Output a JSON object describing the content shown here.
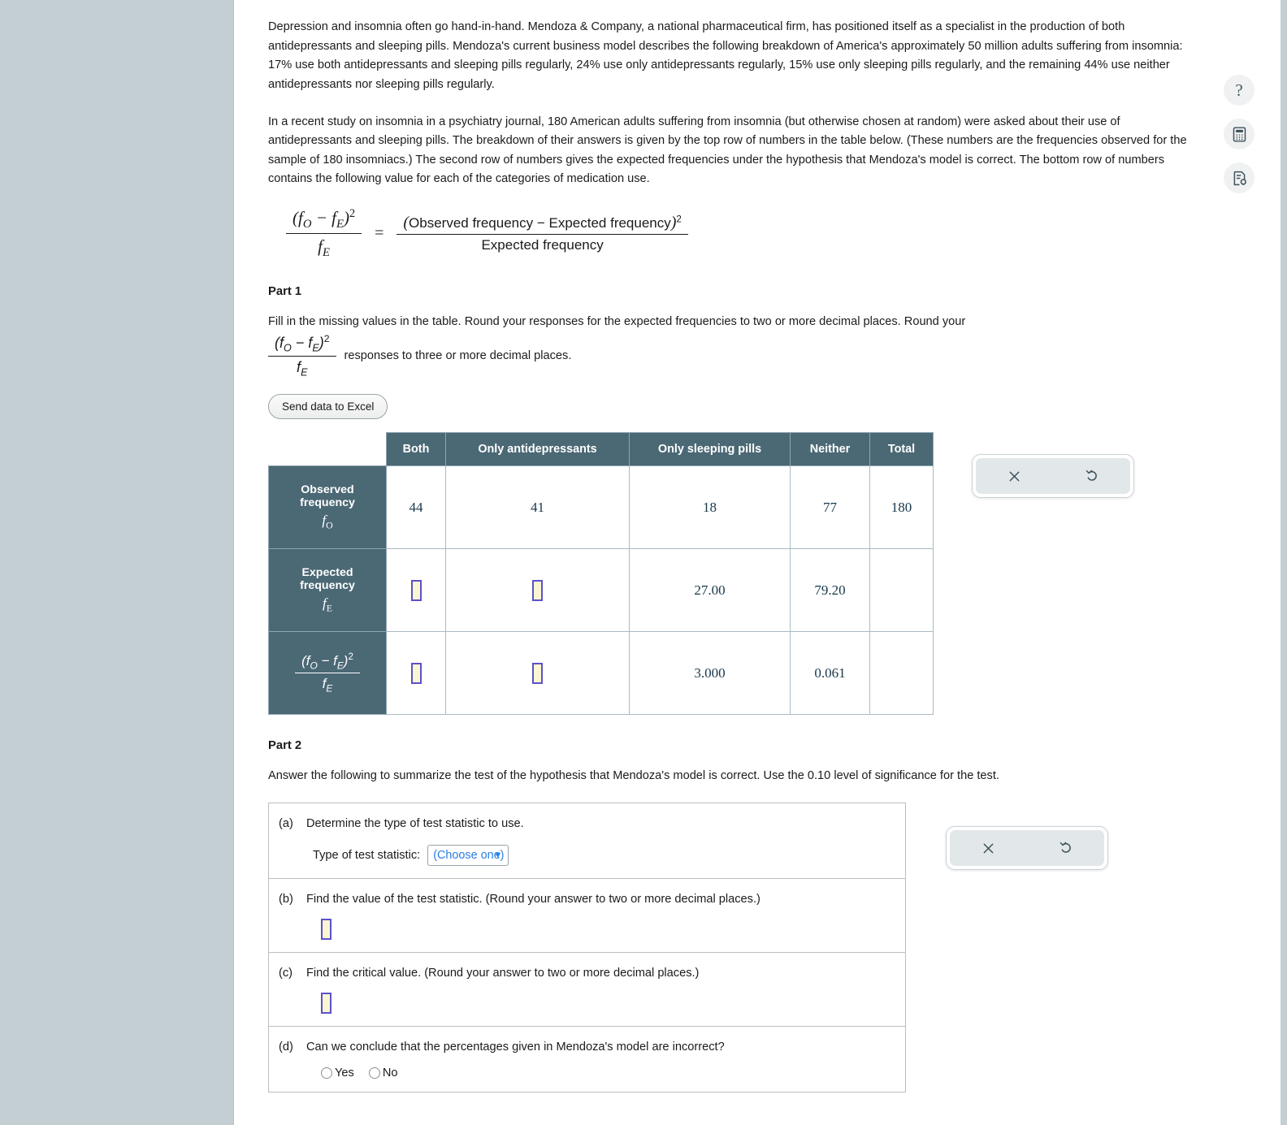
{
  "rails": {
    "left_color": "#c4cfd4",
    "right_color": "#c4cfd4"
  },
  "tool_icons": [
    {
      "name": "help-icon",
      "glyph": "?"
    },
    {
      "name": "calculator-icon",
      "glyph": "calculator"
    },
    {
      "name": "hint-icon",
      "glyph": "hint-sheet"
    }
  ],
  "intro": {
    "paragraph1": "Depression and insomnia often go hand-in-hand. Mendoza & Company, a national pharmaceutical firm, has positioned itself as a specialist in the production of both antidepressants and sleeping pills. Mendoza's current business model describes the following breakdown of America's approximately 50 million adults suffering from insomnia: 17% use both antidepressants and sleeping pills regularly, 24% use only antidepressants regularly, 15% use only sleeping pills regularly, and the remaining 44% use neither antidepressants nor sleeping pills regularly.",
    "paragraph2": "In a recent study on insomnia in a psychiatry journal, 180 American adults suffering from insomnia (but otherwise chosen at random) were asked about their use of antidepressants and sleeping pills. The breakdown of their answers is given by the top row of numbers in the table below. (These numbers are the frequencies observed for the sample of 180 insomniacs.) The second row of numbers gives the expected frequencies under the hypothesis that Mendoza's model is correct. The bottom row of numbers contains the following value for each of the categories of medication use."
  },
  "formula": {
    "lhs_numerator": "(f_O − f_E)²",
    "lhs_denominator": "f_E",
    "equals": "=",
    "rhs_numerator": "(Observed frequency − Expected frequency)²",
    "rhs_denominator": "Expected frequency"
  },
  "part1": {
    "heading": "Part 1",
    "instruction_before": "Fill in the missing values in the table. Round your responses for the expected frequencies to two or more decimal places. Round your",
    "instruction_after": "responses to three or more decimal places.",
    "excel_button": "Send data to Excel"
  },
  "table": {
    "column_headers": [
      "Both",
      "Only antidepressants",
      "Only sleeping pills",
      "Neither",
      "Total"
    ],
    "rows": [
      {
        "label_line1": "Observed",
        "label_line2": "frequency",
        "symbol": "f_O",
        "values": [
          "44",
          "41",
          "18",
          "77",
          "180"
        ],
        "inputs": [
          false,
          false,
          false,
          false,
          false
        ]
      },
      {
        "label_line1": "Expected",
        "label_line2": "frequency",
        "symbol": "f_E",
        "values": [
          "",
          "",
          "27.00",
          "79.20",
          ""
        ],
        "inputs": [
          true,
          true,
          false,
          false,
          false
        ]
      },
      {
        "label_line1": "",
        "label_line2": "",
        "symbol": "(f_O − f_E)² / f_E",
        "values": [
          "",
          "",
          "3.000",
          "0.061",
          ""
        ],
        "inputs": [
          true,
          true,
          false,
          false,
          false
        ]
      }
    ]
  },
  "part2": {
    "heading": "Part 2",
    "instruction": "Answer the following to summarize the test of the hypothesis that Mendoza's model is correct. Use the 0.10 level of significance for the test.",
    "questions": [
      {
        "label": "(a)",
        "text": "Determine the type of test statistic to use.",
        "sub_label": "Type of test statistic:",
        "select_value": "(Choose one)",
        "select_options": [
          "(Choose one)"
        ]
      },
      {
        "label": "(b)",
        "text": "Find the value of the test statistic. (Round your answer to two or more decimal places.)",
        "input_value": ""
      },
      {
        "label": "(c)",
        "text": "Find the critical value. (Round your answer to two or more decimal places.)",
        "input_value": ""
      },
      {
        "label": "(d)",
        "text": "Can we conclude that the percentages given in Mendoza's model are incorrect?",
        "radio_options": [
          "Yes",
          "No"
        ],
        "selected": null
      }
    ]
  },
  "control_panels": [
    {
      "name": "panel-table",
      "clear_icon": "×",
      "undo_icon": "↺"
    },
    {
      "name": "panel-part2",
      "clear_icon": "×",
      "undo_icon": "↺"
    }
  ],
  "colors": {
    "table_header_bg": "#4b6875",
    "input_fill": "#fbf6d2",
    "input_border": "#5b52c9",
    "link_blue": "#2a7fe8",
    "rail_gray": "#c4cfd4"
  }
}
